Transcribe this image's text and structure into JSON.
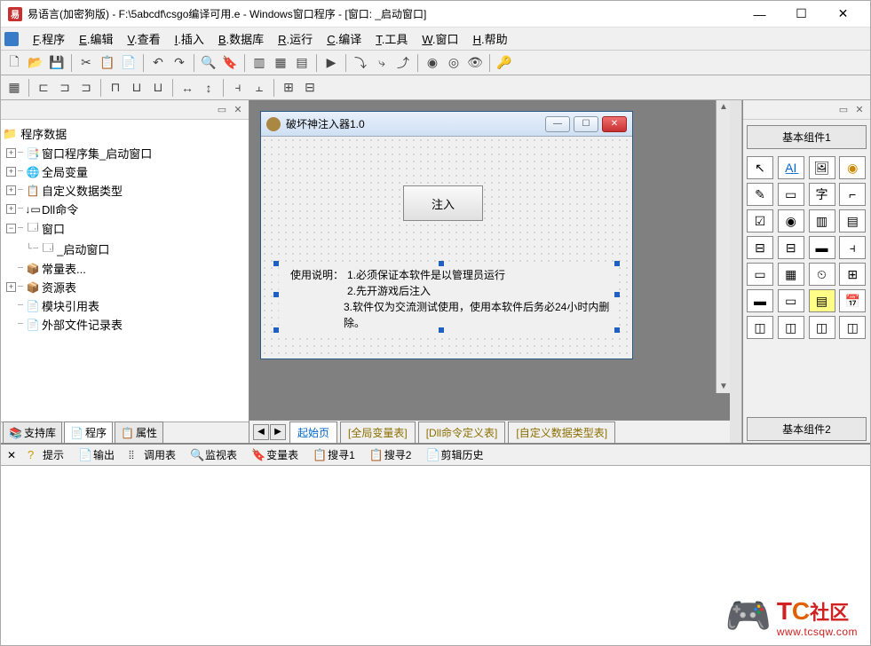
{
  "titlebar": {
    "text": "易语言(加密狗版) - F:\\5abcdf\\csgo编译可用.e - Windows窗口程序 - [窗口: _启动窗口]"
  },
  "menu": {
    "items": [
      {
        "key": "F",
        "label": "程序"
      },
      {
        "key": "E",
        "label": "编辑"
      },
      {
        "key": "V",
        "label": "查看"
      },
      {
        "key": "I",
        "label": "插入"
      },
      {
        "key": "B",
        "label": "数据库"
      },
      {
        "key": "R",
        "label": "运行"
      },
      {
        "key": "C",
        "label": "编译"
      },
      {
        "key": "T",
        "label": "工具"
      },
      {
        "key": "W",
        "label": "窗口"
      },
      {
        "key": "H",
        "label": "帮助"
      }
    ]
  },
  "tree": {
    "root": "程序数据",
    "items": [
      {
        "icon": "📑",
        "label": "窗口程序集_启动窗口",
        "expand": "+"
      },
      {
        "icon": "🌐",
        "label": "全局变量",
        "expand": "+"
      },
      {
        "icon": "📋",
        "label": "自定义数据类型",
        "expand": "+"
      },
      {
        "icon": "↓",
        "label": "Dll命令",
        "expand": "+"
      },
      {
        "icon": "🗔",
        "label": "窗口",
        "expand": "-",
        "children": [
          {
            "icon": "🗔",
            "label": "_启动窗口"
          }
        ]
      },
      {
        "icon": "📦",
        "label": "常量表..."
      },
      {
        "icon": "📦",
        "label": "资源表",
        "expand": "+"
      },
      {
        "icon": "📄",
        "label": "模块引用表"
      },
      {
        "icon": "📄",
        "label": "外部文件记录表"
      }
    ]
  },
  "leftTabs": {
    "support": "支持库",
    "program": "程序",
    "property": "属性"
  },
  "designWindow": {
    "title": "破坏神注入器1.0",
    "injectBtn": "注入",
    "usage": {
      "prefix": "使用说明：",
      "lines": [
        "1.必须保证本软件是以管理员运行",
        "2.先开游戏后注入",
        "3.软件仅为交流测试使用，使用本软件后务必24小时内删除。"
      ]
    }
  },
  "centerTabs": {
    "start": "起始页",
    "globals": "[全局变量表]",
    "dll": "[Dll命令定义表]",
    "custom": "[自定义数据类型表]"
  },
  "rightPanel": {
    "title1": "基本组件1",
    "title2": "基本组件2"
  },
  "bottomTabs": {
    "hint": "提示",
    "output": "输出",
    "debug": "调用表",
    "watch": "监视表",
    "vars": "变量表",
    "search1": "搜寻1",
    "search2": "搜寻2",
    "clip": "剪辑历史"
  },
  "watermark": {
    "logoT": "T",
    "logoC": "C",
    "logoS": "社区",
    "url": "www.tcsqw.com"
  }
}
